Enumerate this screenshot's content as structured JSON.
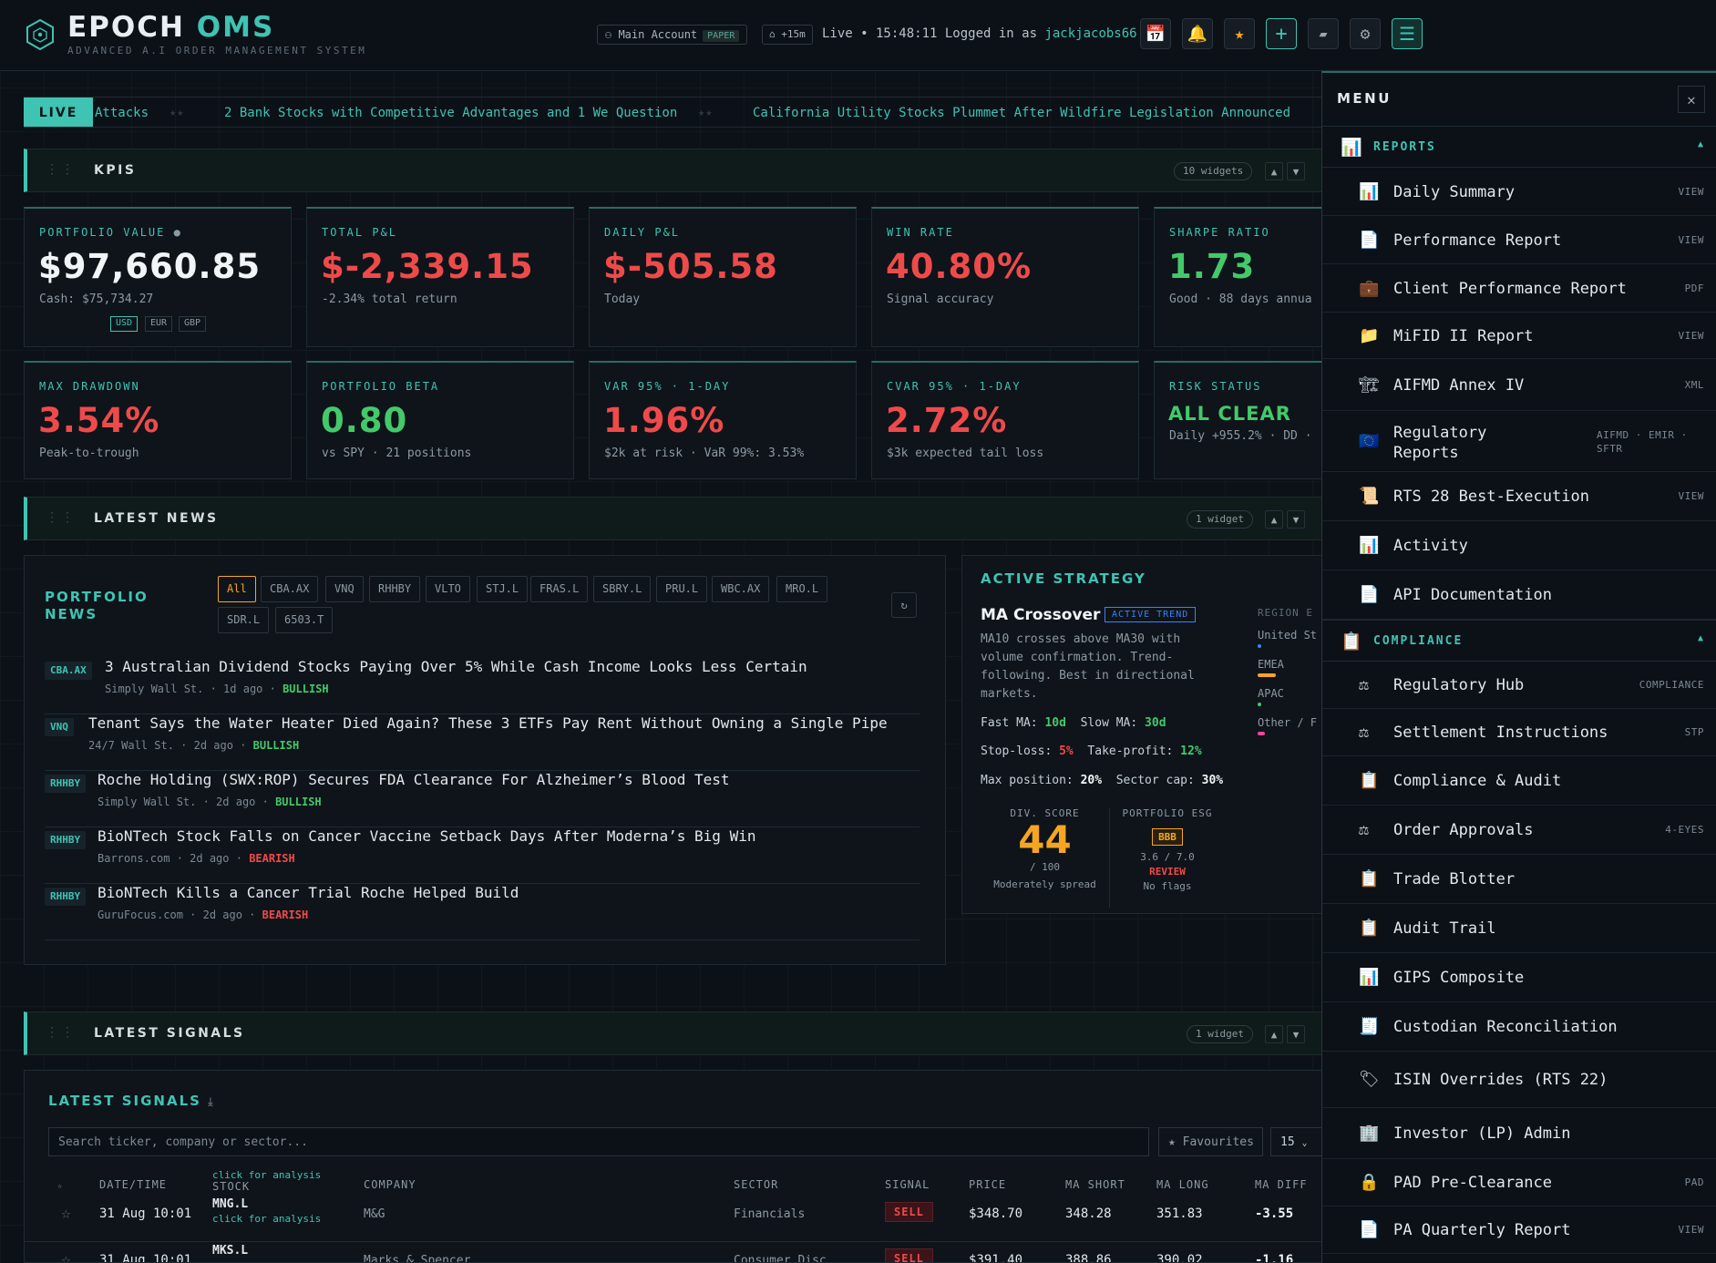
{
  "header": {
    "brand_main": "EPOCH",
    "brand_accent": "OMS",
    "tagline": "ADVANCED A.I ORDER MANAGEMENT SYSTEM",
    "account": "Main Account",
    "account_mode": "PAPER",
    "delay": "+15m",
    "status_prefix": "Live • 15:48:11 Logged in as",
    "user": "jackjacobs66",
    "icons": [
      "calendar-icon",
      "bell-icon",
      "star-icon",
      "plus-icon",
      "chat-icon",
      "gear-icon",
      "hamburger-menu-icon"
    ]
  },
  "ticker": {
    "badge": "LIVE",
    "items": [
      "Attacks",
      "2 Bank Stocks with Competitive Advantages and 1 We Question",
      "California Utility Stocks Plummet After Wildfire Legislation Announced"
    ]
  },
  "sections": {
    "kpis": {
      "title": "KPIS",
      "count": "10 widgets"
    },
    "news": {
      "title": "LATEST NEWS",
      "count": "1 widget"
    },
    "signals": {
      "title": "LATEST SIGNALS",
      "count": "1 widget"
    }
  },
  "kpis": [
    {
      "label": "PORTFOLIO VALUE",
      "value": "$97,660.85",
      "sub": "Cash: $75,734.27",
      "color": "#f2f5f7"
    },
    {
      "label": "TOTAL P&L",
      "value": "$-2,339.15",
      "sub": "-2.34% total return",
      "color": "#ef4a4a"
    },
    {
      "label": "DAILY P&L",
      "value": "$-505.58",
      "sub": "Today",
      "color": "#ef4a4a"
    },
    {
      "label": "WIN RATE",
      "value": "40.80%",
      "sub": "Signal accuracy",
      "color": "#ef4a4a"
    },
    {
      "label": "SHARPE RATIO",
      "value": "1.73",
      "sub": "Good · 88 days annua",
      "color": "#44c96a"
    },
    {
      "label": "MAX DRAWDOWN",
      "value": "3.54%",
      "sub": "Peak-to-trough",
      "color": "#ef4a4a"
    },
    {
      "label": "PORTFOLIO BETA",
      "value": "0.80",
      "sub": "vs SPY · 21 positions",
      "color": "#44c96a"
    },
    {
      "label": "VAR 95% · 1-DAY",
      "value": "1.96%",
      "sub": "$2k at risk · VaR 99%: 3.53%",
      "color": "#ef4a4a"
    },
    {
      "label": "CVAR 95% · 1-DAY",
      "value": "2.72%",
      "sub": "$3k expected tail loss",
      "color": "#ef4a4a"
    },
    {
      "label": "RISK STATUS",
      "value": "ALL CLEAR",
      "sub": "Daily +955.2% · DD ·",
      "color": "#44c96a"
    }
  ],
  "currencies": [
    "USD",
    "EUR",
    "GBP"
  ],
  "portfolio_news": {
    "title": "PORTFOLIO NEWS",
    "filters": [
      "All",
      "CBA.AX",
      "VNQ",
      "RHHBY",
      "VLTO",
      "STJ.L",
      "FRAS.L",
      "SBRY.L",
      "PRU.L",
      "WBC.AX",
      "MRO.L",
      "SDR.L",
      "6503.T"
    ],
    "refresh_icon": "refresh-icon",
    "items": [
      {
        "ticker": "CBA.AX",
        "headline": "3 Australian Dividend Stocks Paying Over 5% While Cash Income Looks Less Certain",
        "meta": "Simply Wall St. · 1d ago ·",
        "sentiment": "BULLISH"
      },
      {
        "ticker": "VNQ",
        "headline": "Tenant Says the Water Heater Died Again? These 3 ETFs Pay Rent Without Owning a Single Pipe",
        "meta": "24/7 Wall St. · 2d ago ·",
        "sentiment": "BULLISH"
      },
      {
        "ticker": "RHHBY",
        "headline": "Roche Holding (SWX:ROP) Secures FDA Clearance For Alzheimer’s Blood Test",
        "meta": "Simply Wall St. · 2d ago ·",
        "sentiment": "BULLISH"
      },
      {
        "ticker": "RHHBY",
        "headline": "BioNTech Stock Falls on Cancer Vaccine Setback Days After Moderna’s Big Win",
        "meta": "Barrons.com · 2d ago ·",
        "sentiment": "BEARISH"
      },
      {
        "ticker": "RHHBY",
        "headline": "BioNTech Kills a Cancer Trial Roche Helped Build",
        "meta": "GuruFocus.com · 2d ago ·",
        "sentiment": "BEARISH"
      }
    ]
  },
  "strategy": {
    "title": "ACTIVE STRATEGY",
    "name": "MA Crossover",
    "badge": "ACTIVE TREND",
    "desc": "MA10 crosses above MA30 with volume confirmation. Trend-following. Best in directional markets.",
    "fast_label": "Fast MA:",
    "fast": "10d",
    "slow_label": "Slow MA:",
    "slow": "30d",
    "sl_label": "Stop-loss:",
    "sl": "5%",
    "tp_label": "Take-profit:",
    "tp": "12%",
    "mp_label": "Max position:",
    "mp": "20%",
    "sc_label": "Sector cap:",
    "sc": "30%",
    "div_label": "DIV. SCORE",
    "div_score": "44",
    "div_max": "/ 100",
    "div_note": "Moderately spread",
    "esg_label": "PORTFOLIO ESG",
    "esg_rating": "BBB",
    "esg_score": "3.6 / 7.0",
    "esg_status": "REVIEW",
    "esg_note": "No flags",
    "region_label": "REGION E",
    "regions": [
      {
        "name": "United St",
        "color": "#3b82f6",
        "level": 0.05
      },
      {
        "name": "EMEA",
        "color": "#f5a524",
        "level": 0.5
      },
      {
        "name": "APAC",
        "color": "#44c96a",
        "level": 0.05
      },
      {
        "name": "Other / F",
        "color": "#ec4899",
        "level": 0.2
      }
    ]
  },
  "signals": {
    "title": "LATEST SIGNALS",
    "search_placeholder": "Search ticker, company or sector...",
    "favourites": "★ Favourites",
    "page_size": "15",
    "columns": [
      "DATE/TIME",
      "STOCK",
      "COMPANY",
      "SECTOR",
      "SIGNAL",
      "PRICE",
      "MA SHORT",
      "MA LONG",
      "MA DIFF"
    ],
    "hint": "click for analysis",
    "rows": [
      {
        "date": "31 Aug 10:01",
        "stock": "MNG.L",
        "company": "M&G",
        "sector": "Financials",
        "signal": "SELL",
        "price": "$348.70",
        "ma_short": "348.28",
        "ma_long": "351.83",
        "ma_diff": "-3.55"
      },
      {
        "date": "31 Aug 10:01",
        "stock": "MKS.L",
        "company": "Marks & Spencer",
        "sector": "Consumer Disc.",
        "signal": "SELL",
        "price": "$391.40",
        "ma_short": "388.86",
        "ma_long": "390.02",
        "ma_diff": "-1.16"
      }
    ]
  },
  "menu": {
    "title": "MENU",
    "groups": [
      {
        "label": "REPORTS",
        "icon": "📊",
        "items": [
          {
            "icon": "📊",
            "label": "Daily Summary",
            "tag": "VIEW"
          },
          {
            "icon": "📄",
            "label": "Performance Report",
            "tag": "VIEW"
          },
          {
            "icon": "💼",
            "label": "Client Performance Report",
            "tag": "PDF"
          },
          {
            "icon": "📁",
            "label": "MiFID II Report",
            "tag": "VIEW"
          },
          {
            "icon": "🏗",
            "label": "AIFMD Annex IV",
            "tag": "XML"
          },
          {
            "icon": "🇪🇺",
            "label": "Regulatory Reports",
            "tag": "AIFMD · EMIR · SFTR"
          },
          {
            "icon": "📜",
            "label": "RTS 28 Best-Execution",
            "tag": "VIEW"
          },
          {
            "icon": "📊",
            "label": "Activity",
            "tag": ""
          },
          {
            "icon": "📄",
            "label": "API Documentation",
            "tag": ""
          }
        ]
      },
      {
        "label": "COMPLIANCE",
        "icon": "📋",
        "items": [
          {
            "icon": "⚖",
            "label": "Regulatory Hub",
            "tag": "COMPLIANCE"
          },
          {
            "icon": "⚖",
            "label": "Settlement Instructions",
            "tag": "STP"
          },
          {
            "icon": "📋",
            "label": "Compliance & Audit",
            "tag": ""
          },
          {
            "icon": "⚖",
            "label": "Order Approvals",
            "tag": "4-EYES"
          },
          {
            "icon": "📋",
            "label": "Trade Blotter",
            "tag": ""
          },
          {
            "icon": "📋",
            "label": "Audit Trail",
            "tag": ""
          },
          {
            "icon": "📊",
            "label": "GIPS Composite",
            "tag": ""
          },
          {
            "icon": "🧾",
            "label": "Custodian Reconciliation",
            "tag": ""
          },
          {
            "icon": "🏷",
            "label": "ISIN Overrides (RTS 22)",
            "tag": ""
          },
          {
            "icon": "🏢",
            "label": "Investor (LP) Admin",
            "tag": ""
          },
          {
            "icon": "🔒",
            "label": "PAD Pre-Clearance",
            "tag": "PAD"
          },
          {
            "icon": "📄",
            "label": "PA Quarterly Report",
            "tag": "VIEW"
          }
        ]
      }
    ]
  }
}
